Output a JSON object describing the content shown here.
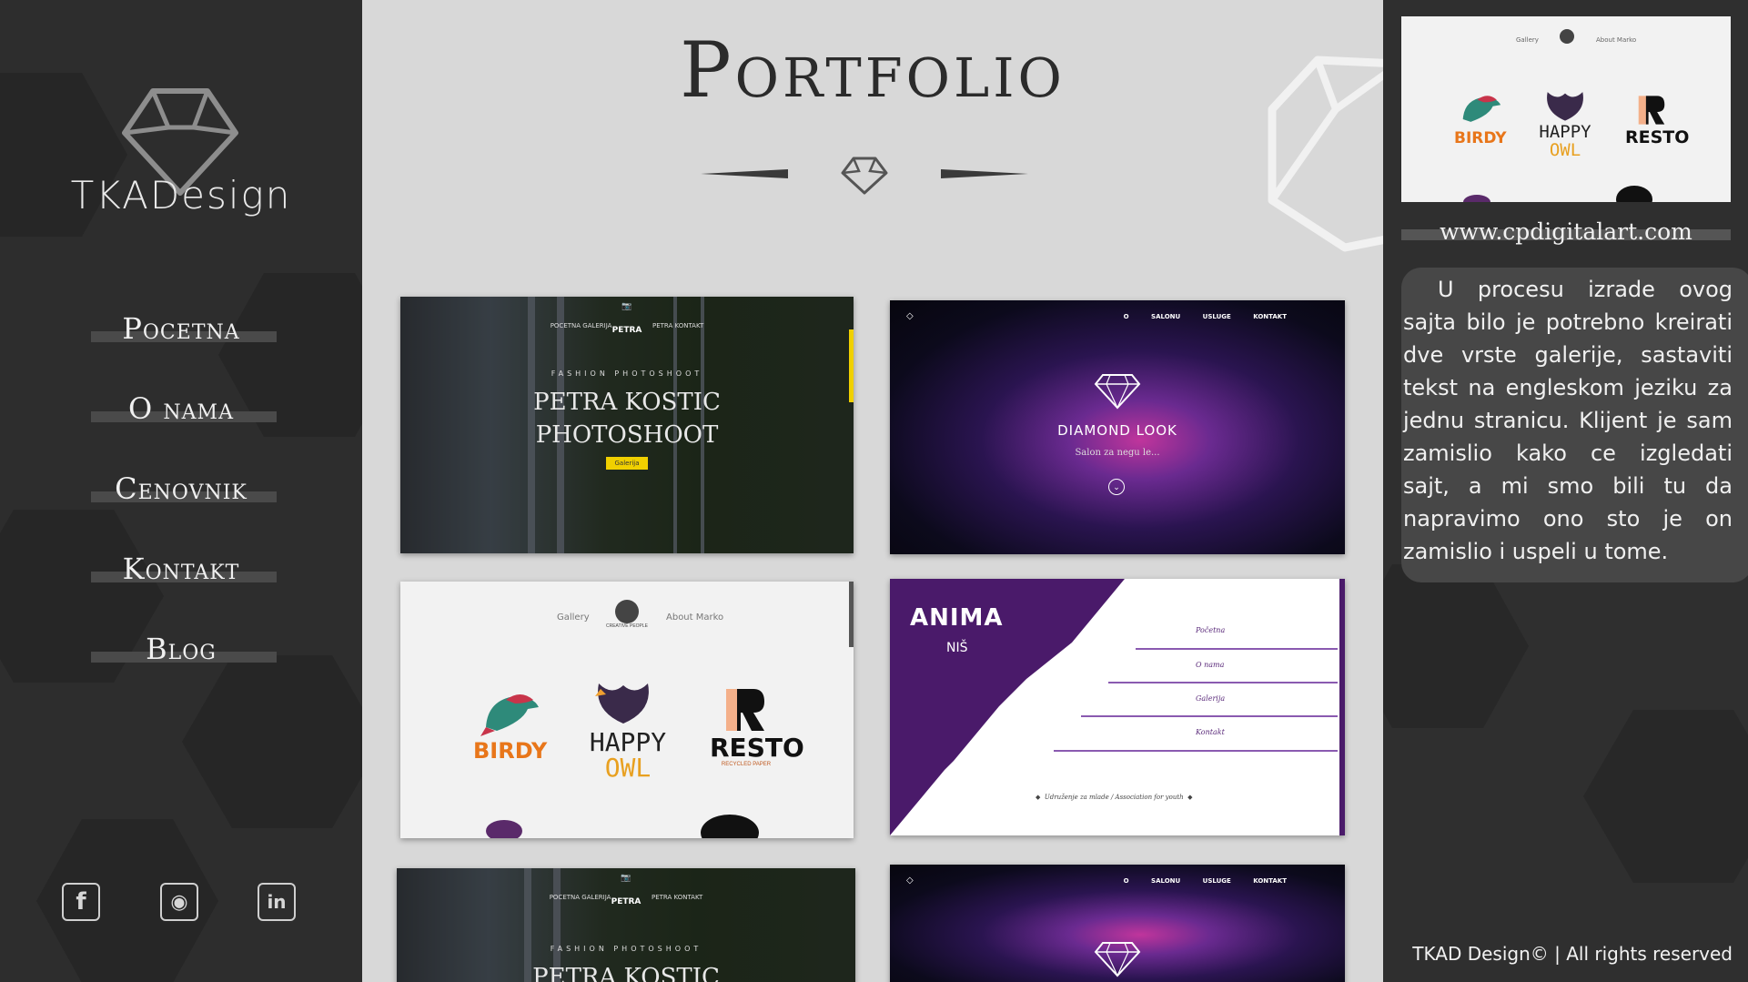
{
  "brand": {
    "name": "TKADesign"
  },
  "nav": {
    "items": [
      "Pocetna",
      "O nama",
      "Cenovnik",
      "Kontakt",
      "Blog"
    ]
  },
  "social": {
    "facebook": "f",
    "instagram": "◉",
    "linkedin": "in"
  },
  "main": {
    "title": "Portfolio"
  },
  "cards": {
    "photoshoot": {
      "nav_left": "POCETNA    GALERIJA",
      "nav_right": "PETRA    KONTAKT",
      "brand": "PETRA",
      "eyebrow": "FASHION PHOTOSHOOT",
      "title_line1": "PETRA KOSTIC",
      "title_line2": "PHOTOSHOOT",
      "button": "Galerija"
    },
    "diamond": {
      "nav": "O SALONU USLUGE KONTAKT",
      "title": "DIAMOND LOOK",
      "subtitle": "Salon za negu le..."
    },
    "logos": {
      "nav_left": "Gallery",
      "nav_right": "About Marko",
      "center_logo": "CREATIVE PEOPLE",
      "logo1": "BIRDY",
      "logo2_line1": "HAPPY",
      "logo2_line2": "OWL",
      "logo3": "RESTO",
      "logo3_sub": "RECYCLED PAPER"
    },
    "anima": {
      "brand": "ANIMA",
      "city": "NIŠ",
      "menu": [
        "Početna",
        "O nama",
        "Galerija",
        "Kontakt"
      ],
      "footer": "Udruženje za mlade / Association for youth"
    }
  },
  "right": {
    "preview": {
      "nav_left": "Gallery",
      "nav_right": "About Marko",
      "logo1": "BIRDY",
      "logo2_line1": "HAPPY",
      "logo2_line2": "OWL",
      "logo3": "RESTO"
    },
    "url": "www.cpdigitalart.com",
    "description": "U procesu izrade ovog sajta bilo je potrebno kreirati dve vrste galerije, sastaviti tekst na engleskom jeziku za jednu stranicu. Klijent je sam zamislio kako ce izgledati sajt, a mi smo bili tu da napravimo ono sto je on zamislio i uspeli u tome.",
    "footer": "TKAD Design© | All rights reserved"
  },
  "colors": {
    "sidebar": "#2d2d2d",
    "main_bg": "#d8d8d8",
    "accent_yellow": "#f0d000",
    "anima_purple": "#4a1a6a",
    "birdy_orange": "#e8761a",
    "owl_purple": "#3a2a4a"
  }
}
